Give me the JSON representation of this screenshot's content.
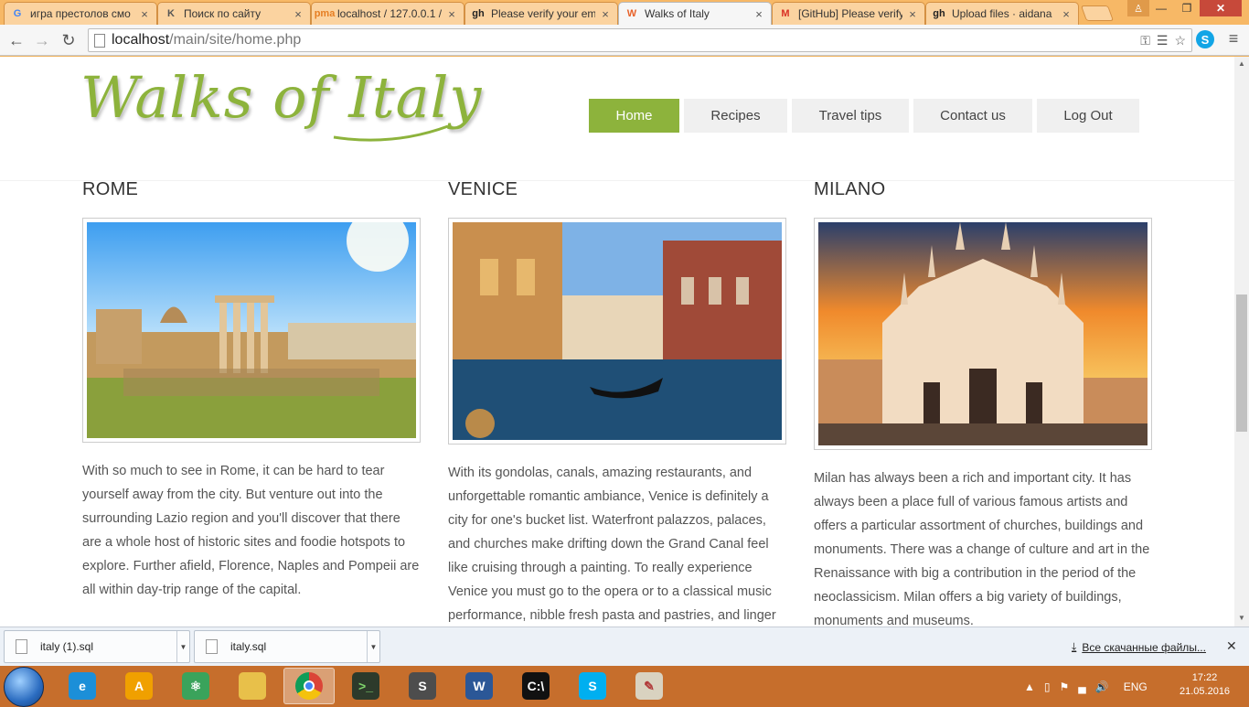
{
  "browser": {
    "tabs": [
      {
        "title": "игра престолов смо",
        "favicon": "G",
        "favicon_color": "#4285f4"
      },
      {
        "title": "Поиск по сайту",
        "favicon": "K",
        "favicon_color": "#555555"
      },
      {
        "title": "localhost / 127.0.0.1 /",
        "favicon": "pma",
        "favicon_color": "#e67e22"
      },
      {
        "title": "Please verify your em",
        "favicon": "gh",
        "favicon_color": "#222222"
      },
      {
        "title": "Walks of Italy",
        "favicon": "W",
        "favicon_color": "#e8622a"
      },
      {
        "title": "[GitHub] Please verify",
        "favicon": "M",
        "favicon_color": "#d93025"
      },
      {
        "title": "Upload files · aidana",
        "favicon": "gh",
        "favicon_color": "#222222"
      }
    ],
    "active_tab": 4,
    "url_host": "localhost",
    "url_path": "/main/site/home.php",
    "extension_skype": "S"
  },
  "site": {
    "logo": "Walks of Italy",
    "nav": [
      {
        "label": "Home",
        "active": true
      },
      {
        "label": "Recipes",
        "active": false
      },
      {
        "label": "Travel tips",
        "active": false
      },
      {
        "label": "Contact us",
        "active": false
      },
      {
        "label": "Log Out",
        "active": false
      }
    ],
    "accent": "#8db33c",
    "cities": [
      {
        "name": "ROME",
        "image": "rome-forum-photo",
        "text": "With so much to see in Rome, it can be hard to tear yourself away from the city. But venture out into the surrounding Lazio region and you'll discover that there are a whole host of historic sites and foodie hotspots to explore. Further afield, Florence, Naples and Pompeii are all within day-trip range of the capital."
      },
      {
        "name": "VENICE",
        "image": "venice-canal-photo",
        "text": "With its gondolas, canals, amazing restaurants, and unforgettable romantic ambiance, Venice is definitely a city for one's bucket list. Waterfront palazzos, palaces, and churches make drifting down the Grand Canal feel like cruising through a painting. To really experience Venice you must go to the opera or to a classical music performance, nibble fresh pasta and pastries, and linger"
      },
      {
        "name": "MILANO",
        "image": "milan-duomo-photo",
        "text": "Milan has always been a rich and important city. It has always been a place full of various famous artists and offers a particular assortment of churches, buildings and monuments. There was a change of culture and art in the Renaissance with big a contribution in the period of the neoclassicism. Milan offers a big variety of buildings, monuments and museums."
      }
    ]
  },
  "downloads": {
    "items": [
      "italy (1).sql",
      "italy.sql"
    ],
    "all_label": "Все скачанные файлы..."
  },
  "taskbar": {
    "apps": [
      {
        "name": "internet-explorer",
        "glyph": "e",
        "color": "#1c8fd8"
      },
      {
        "name": "aimp",
        "glyph": "A",
        "color": "#f0a000"
      },
      {
        "name": "atom",
        "glyph": "⚛",
        "color": "#3aa35b"
      },
      {
        "name": "file-explorer",
        "glyph": "",
        "color": "#e8c04a"
      },
      {
        "name": "chrome",
        "glyph": "",
        "color": "#ffffff"
      },
      {
        "name": "terminal-app",
        "glyph": ">_",
        "color": "#2d3a2b"
      },
      {
        "name": "sublime-text",
        "glyph": "S",
        "color": "#4d4d4d"
      },
      {
        "name": "word",
        "glyph": "W",
        "color": "#2b5797"
      },
      {
        "name": "cmd",
        "glyph": "C:\\",
        "color": "#111111"
      },
      {
        "name": "skype",
        "glyph": "S",
        "color": "#00aff0"
      },
      {
        "name": "paint",
        "glyph": "✎",
        "color": "#d9d2c0"
      }
    ],
    "active_app": 4,
    "language": "ENG",
    "time": "17:22",
    "date": "21.05.2016"
  }
}
